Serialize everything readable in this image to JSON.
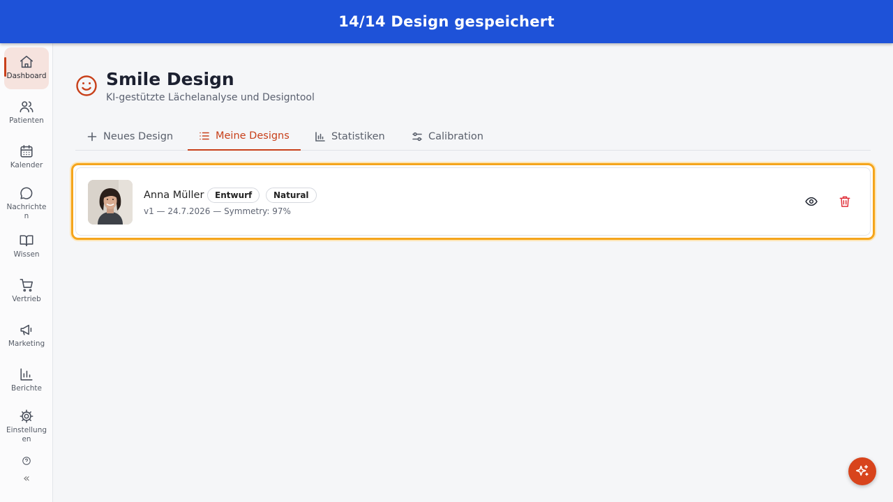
{
  "banner": {
    "text": "14/14 Design gespeichert"
  },
  "sidebar": {
    "items": [
      {
        "label": "Dashboard",
        "icon": "home-icon"
      },
      {
        "label": "Patienten",
        "icon": "users-icon"
      },
      {
        "label": "Kalender",
        "icon": "calendar-icon"
      },
      {
        "label": "Nachrichten",
        "icon": "message-icon"
      },
      {
        "label": "Wissen",
        "icon": "book-icon"
      },
      {
        "label": "Vertrieb",
        "icon": "cart-icon"
      },
      {
        "label": "Marketing",
        "icon": "megaphone-icon"
      },
      {
        "label": "Berichte",
        "icon": "bar-chart-icon"
      },
      {
        "label": "Einstellungen",
        "icon": "gear-icon"
      }
    ],
    "collapse_label": "«"
  },
  "page": {
    "title": "Smile Design",
    "subtitle": "KI-gestützte Lächelanalyse und Designtool"
  },
  "tabs": [
    {
      "label": "Neues Design",
      "icon": "plus-icon"
    },
    {
      "label": "Meine Designs",
      "icon": "list-icon",
      "active": true
    },
    {
      "label": "Statistiken",
      "icon": "bar-chart-icon"
    },
    {
      "label": "Calibration",
      "icon": "sliders-icon"
    }
  ],
  "designs": [
    {
      "patient": "Anna Müller",
      "badges": [
        "Entwurf",
        "Natural"
      ],
      "meta": "v1 — 24.7.2026 — Symmetry: 97%"
    }
  ],
  "colors": {
    "banner": "#1e52d8",
    "accent": "#c8401a",
    "highlight": "#f5a51c",
    "delete": "#e0303a"
  }
}
